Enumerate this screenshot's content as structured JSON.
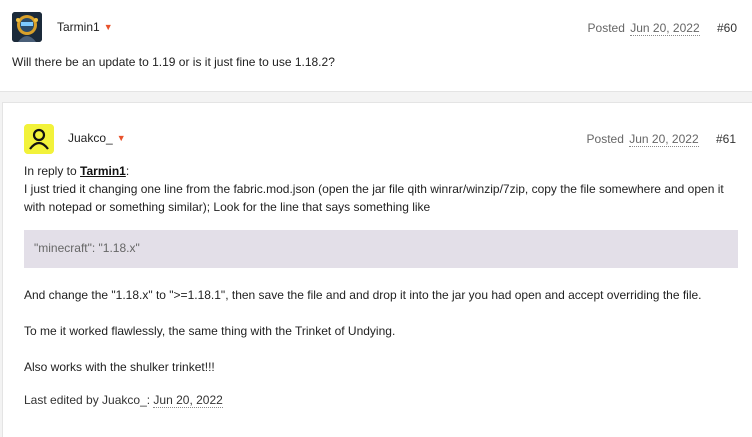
{
  "posts": [
    {
      "author": "Tarmin1",
      "posted_label": "Posted",
      "date": "Jun 20, 2022",
      "number": "#60",
      "content": "Will there be an update to 1.19 or is it just fine to use 1.18.2?"
    },
    {
      "author": "Juakco_",
      "posted_label": "Posted",
      "date": "Jun 20, 2022",
      "number": "#61",
      "reply_prefix": "In reply to ",
      "reply_to": "Tarmin1",
      "reply_suffix": ":",
      "para1": " I just tried it changing one line from the fabric.mod.json (open the jar file qith winrar/winzip/7zip, copy the file somewhere and  open it with notepad or something similar); Look for the line that says something like",
      "code": "\"minecraft\": \"1.18.x\"",
      "para2": "And change the \"1.18.x\" to \">=1.18.1\", then save the file and and drop it into the jar you had open and accept overriding the file.",
      "para3": "To me it worked flawlessly, the same thing with the Trinket of Undying.",
      "para4": "Also works with the shulker trinket!!!",
      "edited_prefix": "Last edited by Juakco_: ",
      "edited_date": "Jun 20, 2022"
    }
  ],
  "colors": {
    "accent_caret": "#e8522c",
    "quote_bg": "#e3dfe8",
    "avatar2_bg": "#f2f23a"
  },
  "icons": {
    "avatar1": "game-character-avatar",
    "avatar2": "user-silhouette-icon",
    "caret": "caret-down-icon"
  }
}
